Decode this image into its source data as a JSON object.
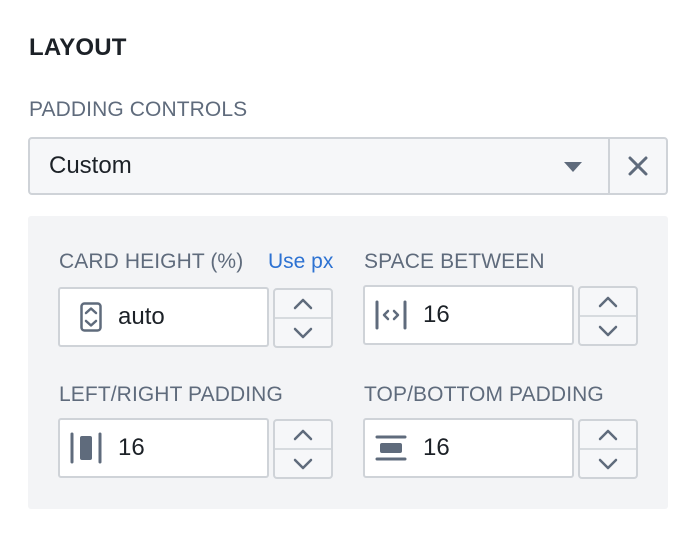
{
  "layout": {
    "title": "LAYOUT",
    "padding_controls": {
      "label": "PADDING CONTROLS",
      "value": "Custom"
    }
  },
  "fields": {
    "card_height": {
      "label": "CARD HEIGHT (%)",
      "link": "Use px",
      "value": "auto"
    },
    "space_between": {
      "label": "SPACE BETWEEN",
      "value": "16"
    },
    "left_right_padding": {
      "label": "LEFT/RIGHT PADDING",
      "value": "16"
    },
    "top_bottom_padding": {
      "label": "TOP/BOTTOM PADDING",
      "value": "16"
    }
  },
  "icons": {
    "card_height": "auto-height-icon",
    "space_between": "space-between-icon",
    "left_right_padding": "horizontal-padding-icon",
    "top_bottom_padding": "vertical-padding-icon",
    "clear": "close-icon",
    "dropdown": "caret-down-icon",
    "increment": "chevron-up-icon",
    "decrement": "chevron-down-icon"
  },
  "colors": {
    "text": "#1c2127",
    "muted": "#5f6b7c",
    "link": "#2d72d2",
    "border": "#cfd3d8",
    "panel": "#f3f4f6"
  }
}
